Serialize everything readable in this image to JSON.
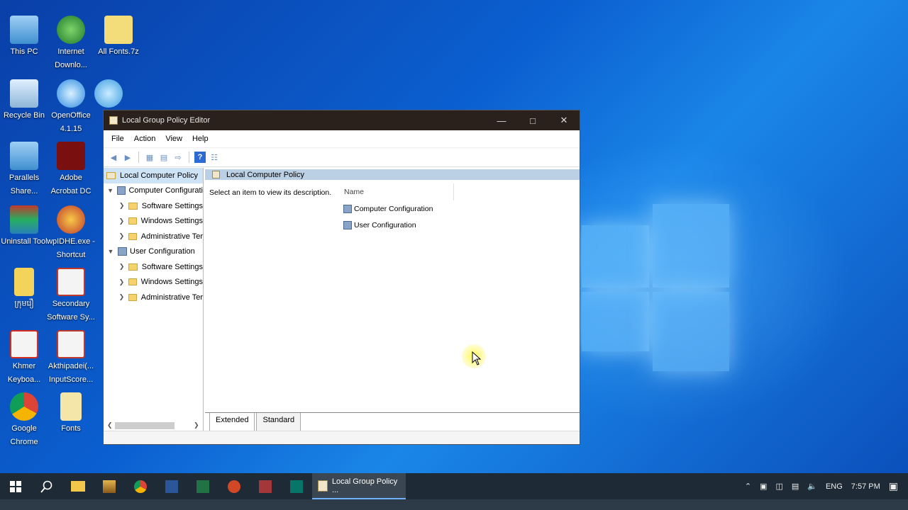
{
  "desktop": {
    "icons": [
      {
        "label": "This PC"
      },
      {
        "label": "Internet Downlo..."
      },
      {
        "label": "All Fonts.7z"
      },
      {
        "label": "Recycle Bin"
      },
      {
        "label": "OpenOffice 4.1.15"
      },
      {
        "label": "Parallels Share..."
      },
      {
        "label": "Adobe Acrobat DC"
      },
      {
        "label": "Uninstall Tool"
      },
      {
        "label": "wpIDHE.exe - Shortcut"
      },
      {
        "label": "ក្រុមរឿ"
      },
      {
        "label": "Secondary Software Sy..."
      },
      {
        "label": "Khmer Keyboa..."
      },
      {
        "label": "Akthipadei(... InputScore..."
      },
      {
        "label": "Google Chrome"
      },
      {
        "label": "Fonts"
      }
    ]
  },
  "window": {
    "title": "Local Group Policy Editor",
    "menu": [
      "File",
      "Action",
      "View",
      "Help"
    ],
    "tree": {
      "root": "Local Computer Policy",
      "computer": "Computer Configurati",
      "computer_children": [
        "Software Settings",
        "Windows Settings",
        "Administrative Ter"
      ],
      "user": "User Configuration",
      "user_children": [
        "Software Settings",
        "Windows Settings",
        "Administrative Ter"
      ]
    },
    "right": {
      "header": "Local Computer Policy",
      "description": "Select an item to view its description.",
      "column_name": "Name",
      "items": [
        "Computer Configuration",
        "User Configuration"
      ]
    },
    "tabs": [
      "Extended",
      "Standard"
    ]
  },
  "taskbar": {
    "active_app": "Local Group Policy ...",
    "language": "ENG",
    "time": "7:57 PM"
  }
}
